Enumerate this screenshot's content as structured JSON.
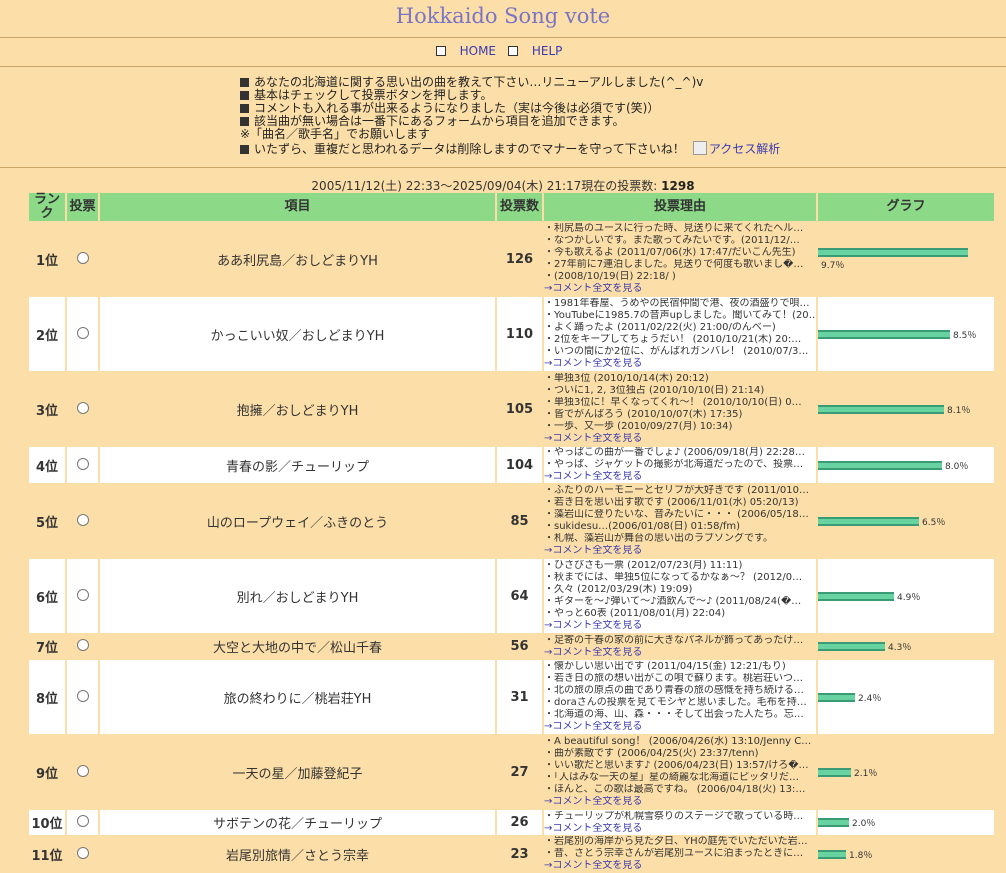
{
  "title": "Hokkaido Song vote",
  "nav": {
    "home": "HOME",
    "help": "HELP"
  },
  "notes": [
    "あなたの北海道に関する思い出の曲を教えて下さい…リニューアルしました(^_^)v",
    "基本はチェックして投票ボタンを押します。",
    "コメントも入れる事が出来るようになりました（実は今後は必須です(笑)）",
    "該当曲が無い場合は一番下にあるフォームから項目を追加できます。",
    "※「曲名／歌手名」でお願いします",
    "いたずら、重複だと思われるデータは削除しますのでマナーを守って下さいね！"
  ],
  "notes_link": "アクセス解析",
  "since": {
    "text": "2005/11/12(土) 22:33〜2025/09/04(木) 21:17現在の投票数:",
    "total": "1298"
  },
  "headers": {
    "rank": "ランク",
    "vote": "投票",
    "item": "項目",
    "count": "投票数",
    "reason": "投票理由",
    "graph": "グラフ"
  },
  "more_label": "→コメント全文を見る",
  "rows": [
    {
      "rank": "1位",
      "item": "ああ利尻島／おしどまりYH",
      "count": "126",
      "pct": 9.7,
      "pct_label": "9.7％",
      "comments": [
        "・利尻島のユースに行った時、見送りに来てくれたヘル…",
        "・なつかしいです。また歌ってみたいです。(2011/12/…",
        "・今も歌えるよ (2011/07/06(水) 17:47/だいこん先生)",
        "・27年前に7連泊しました。見送りで何度も歌いまし�…",
        "・(2008/10/19(日) 22:18/ )"
      ]
    },
    {
      "rank": "2位",
      "item": "かっこいい奴／おしどまりYH",
      "count": "110",
      "pct": 8.5,
      "pct_label": "8.5％",
      "comments": [
        "・1981年春屋、うめやの民宿仲間で港、夜の酒盛りで唄…",
        "・YouTubeに1985.7の音声upしました。聞いてみて！(20…",
        "・よく踊ったよ (2011/02/22(火) 21:00/のんべー)",
        "・2位をキープしてちょうだい！ (2010/10/21(木) 20:…",
        "・いつの間にか2位に、がんばれガンバレ！ (2010/07/3…"
      ]
    },
    {
      "rank": "3位",
      "item": "抱擁／おしどまりYH",
      "count": "105",
      "pct": 8.1,
      "pct_label": "8.1％",
      "comments": [
        "・単独3位 (2010/10/14(木) 20:12)",
        "・ついに1, 2, 3位独占 (2010/10/10(日) 21:14)",
        "・単独3位に！早くなってくれ～！ (2010/10/10(日) 0…",
        "・皆でがんばろう (2010/10/07(木) 17:35)",
        "・一歩、又一歩 (2010/09/27(月) 10:34)"
      ]
    },
    {
      "rank": "4位",
      "item": "青春の影／チューリップ",
      "count": "104",
      "pct": 8.0,
      "pct_label": "8.0％",
      "comments": [
        "・やっぱこの曲が一番でしょ♪ (2006/09/18(月) 22:28…",
        "・やっぱ、ジャケットの撮影が北海道だったので、投票…"
      ]
    },
    {
      "rank": "5位",
      "item": "山のロープウェイ／ふきのとう",
      "count": "85",
      "pct": 6.5,
      "pct_label": "6.5％",
      "comments": [
        "・ふたりのハーモニーとセリフが大好きです (2011/010…",
        "・若き日を思い出す歌です (2006/11/01(水) 05:20/13)",
        "・藻岩山に登りたいな、音みたいに・・・ (2006/05/18…",
        "・sukidesu…(2006/01/08(日) 01:58/fm)",
        "・札幌、藻岩山が舞台の思い出のラブソングです。"
      ]
    },
    {
      "rank": "6位",
      "item": "別れ／おしどまりYH",
      "count": "64",
      "pct": 4.9,
      "pct_label": "4.9％",
      "comments": [
        "・ひさびさも一票 (2012/07/23(月) 11:11)",
        "・秋までには、単独5位になってるかなぁ～？ (2012/0…",
        "・久々 (2012/03/29(木) 19:09)",
        "・ギターを～♪弾いて～♪酒飲んで～♪ (2011/08/24(�…",
        "・やっと60表 (2011/08/01(月) 22:04)"
      ]
    },
    {
      "rank": "7位",
      "item": "大空と大地の中で／松山千春",
      "count": "56",
      "pct": 4.3,
      "pct_label": "4.3％",
      "comments": [
        "・足寄の千春の家の前に大きなパネルが飾ってあったけ…"
      ]
    },
    {
      "rank": "8位",
      "item": "旅の終わりに／桃岩荘YH",
      "count": "31",
      "pct": 2.4,
      "pct_label": "2.4％",
      "comments": [
        "・懐かしい思い出です (2011/04/15(金) 12:21/もり)",
        "・若き日の旅の想い出がこの唄で蘇ります。桃岩荘いつ…",
        "・北の旅の原点の曲であり青春の旅の感慨を持ち続ける…",
        "・doraさんの投票を見てモシヤと思いました。毛布を持…",
        "・北海道の海、山、森・・・そして出会った人たち。忘…"
      ]
    },
    {
      "rank": "9位",
      "item": "一天の星／加藤登紀子",
      "count": "27",
      "pct": 2.1,
      "pct_label": "2.1％",
      "comments": [
        "・A beautiful song！ (2006/04/26(水) 13:10/Jenny C…",
        "・曲が素敵です (2006/04/25(火) 23:37/tenn)",
        "・いい歌だと思います♪ (2006/04/23(日) 13:57/けろ�…",
        "・「人はみな一天の星」星の綺麗な北海道にピッタリだ…",
        "・ほんと、この歌は最高ですね。 (2006/04/18(火) 13:…"
      ]
    },
    {
      "rank": "10位",
      "item": "サボテンの花／チューリップ",
      "count": "26",
      "pct": 2.0,
      "pct_label": "2.0％",
      "comments": [
        "・チューリップが札幌雪祭りのステージで歌っている時…"
      ]
    },
    {
      "rank": "11位",
      "item": "岩尾別旅情／さとう宗幸",
      "count": "23",
      "pct": 1.8,
      "pct_label": "1.8％",
      "comments": [
        "・岩尾別の海岸から見た夕日、YHの庭先でいただいた岩…",
        "・昔、さとう宗幸さんが岩尾別ユースに泊まったときに…"
      ]
    }
  ]
}
